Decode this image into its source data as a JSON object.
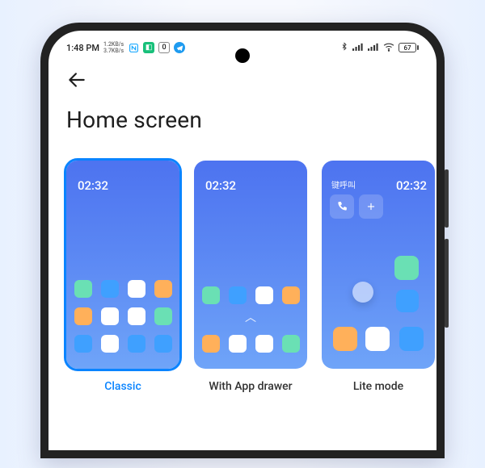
{
  "statusbar": {
    "time": "1:48 PM",
    "speed_up": "1.2KB/s",
    "speed_down": "3.7KB/s",
    "battery_percent": "67"
  },
  "page": {
    "title": "Home screen"
  },
  "options": [
    {
      "label": "Classic",
      "selected": true,
      "preview_time": "02:32"
    },
    {
      "label": "With App drawer",
      "selected": false,
      "preview_time": "02:32"
    },
    {
      "label": "Lite mode",
      "selected": false,
      "preview_time": "02:32",
      "preview_tag": "键呼叫"
    }
  ]
}
